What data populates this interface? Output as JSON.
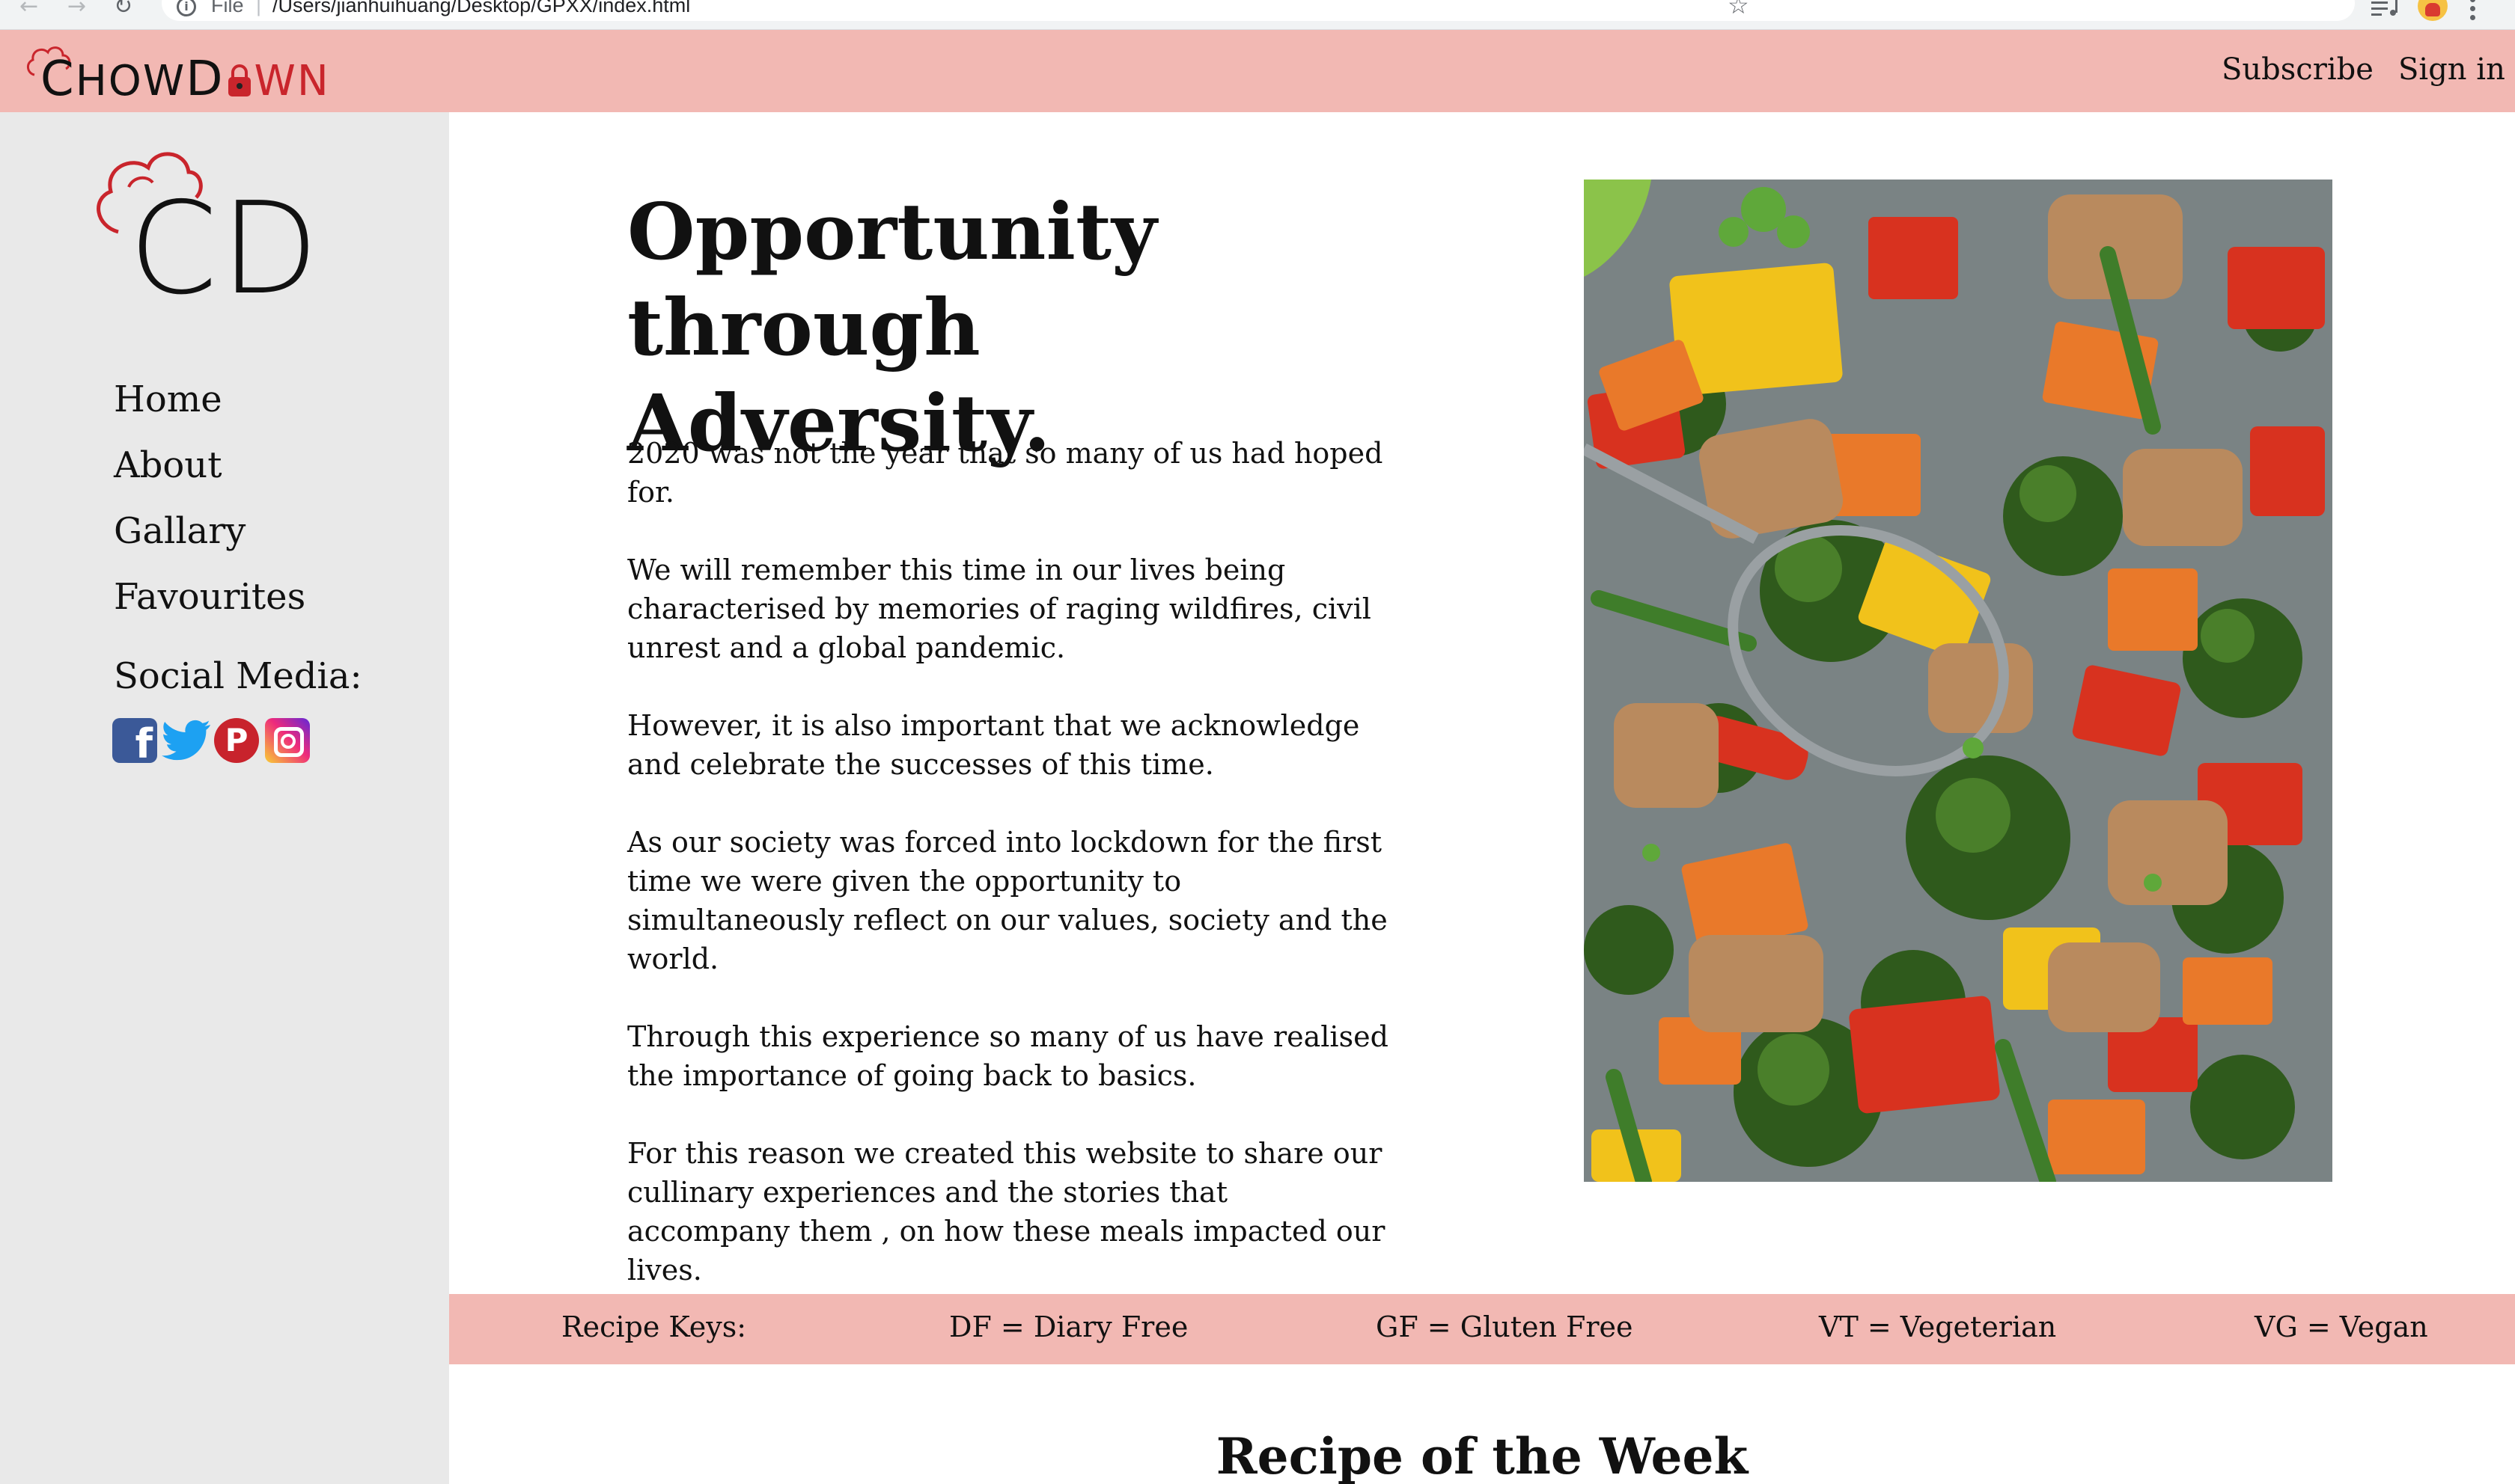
{
  "browser": {
    "url_scheme": "File",
    "url_path": "/Users/jianhuihuang/Desktop/GPXX/index.html",
    "icons": [
      "back-arrow-icon",
      "forward-arrow-icon",
      "reload-icon",
      "info-icon",
      "star-icon",
      "media-control-icon",
      "profile-avatar-icon",
      "menu-dots-icon"
    ]
  },
  "header": {
    "brand": {
      "c": "C",
      "how": "HOW",
      "d": "D",
      "wn": "WN"
    },
    "links": {
      "subscribe": "Subscribe",
      "signin": "Sign in"
    },
    "background_color": "#f2b8b3"
  },
  "sidebar": {
    "logo_text": "CD",
    "nav": [
      "Home",
      "About",
      "Gallary",
      "Favourites"
    ],
    "social_heading": "Social Media:",
    "social_icons": [
      "facebook-icon",
      "twitter-icon",
      "pinterest-icon",
      "instagram-icon"
    ],
    "background_color": "#e9e9e9"
  },
  "hero": {
    "title_line1": "Opportunity",
    "title_line2": "through Adversity.",
    "paragraphs": [
      "2020 was not the year that so many of us had hoped for.",
      "We will remember this time in our lives being characterised by memories of raging wildfires, civil unrest and a global pandemic.",
      "However, it is also important that we acknowledge and celebrate the successes of this time.",
      "As our society was forced into lockdown for the first time we were given the opportunity to simultaneously reflect on our values, society and the world.",
      "Through this experience so many of us have realised the importance of going back to basics.",
      "For this reason we created this website to share our cullinary experiences and the stories that accompany them , on how these meals impacted our lives."
    ]
  },
  "recipe_keys": {
    "label": "Recipe Keys:",
    "df": "DF = Diary Free",
    "gf": "GF = Gluten Free",
    "vt": "VT = Vegeterian",
    "vg": "VG = Vegan"
  },
  "recipe_of_week": {
    "heading": "Recipe of the Week"
  },
  "colors": {
    "accent": "#f2b8b3",
    "brand_red": "#c9252c",
    "sidebar": "#e9e9e9"
  }
}
